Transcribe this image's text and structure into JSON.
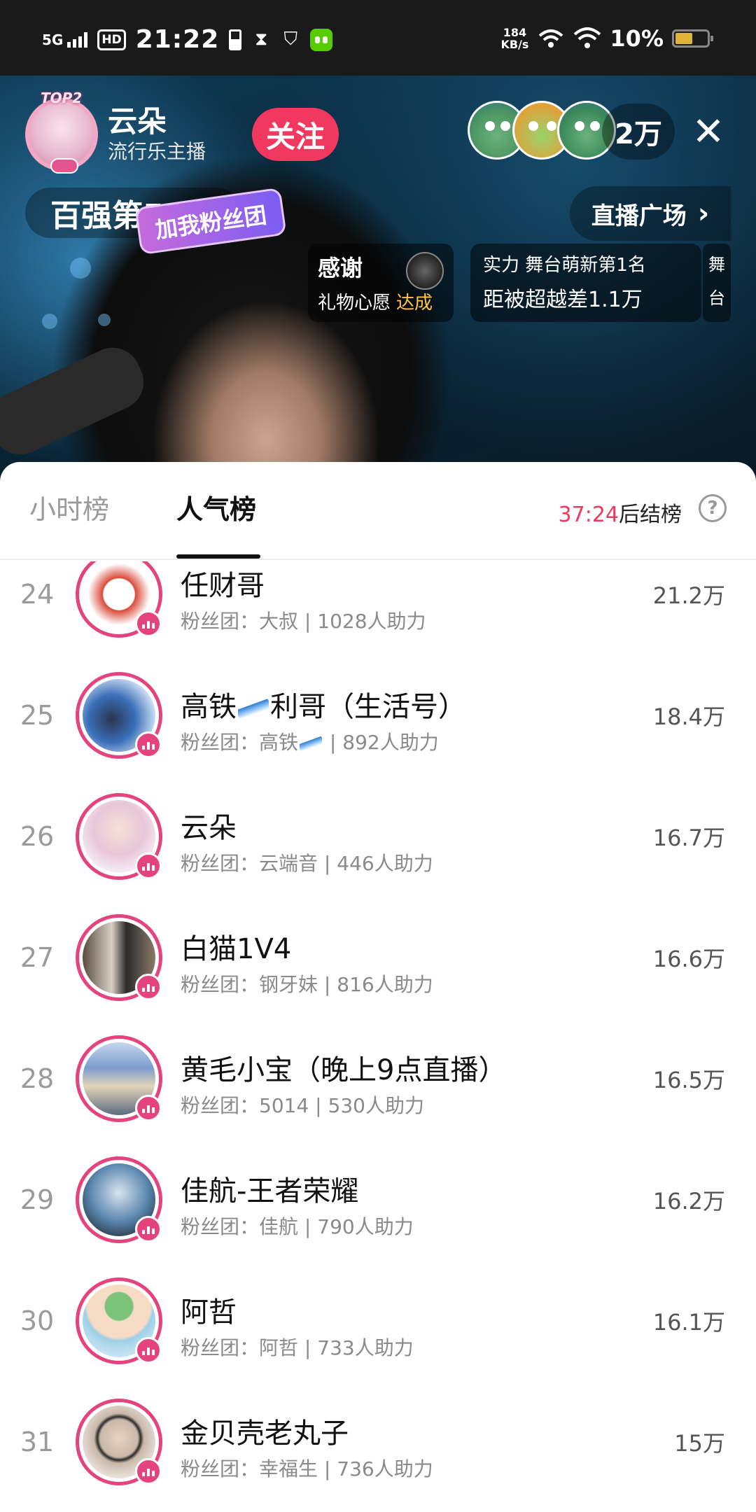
{
  "status_bar": {
    "network": "5G",
    "hd": "HD",
    "time": "21:22",
    "speed_value": "184",
    "speed_unit": "KB/s",
    "battery": "10%"
  },
  "live": {
    "host_badge": "TOP2",
    "host_name": "云朵",
    "host_subtitle": "流行乐主播",
    "follow_label": "关注",
    "viewer_count": "2万",
    "close_symbol": "✕",
    "rank_text": "百强第55名",
    "join_fan_club": "加我粉丝团",
    "plaza_label": "直播广场",
    "thanks_title": "感谢",
    "thanks_sub": "礼物心愿",
    "thanks_status": "达成",
    "stage_top": "实力 舞台萌新第1名",
    "stage_bottom": "距被超越差1.1万",
    "stage_side_1": "舞",
    "stage_side_2": "台"
  },
  "sheet": {
    "tab_hourly": "小时榜",
    "tab_popularity": "人气榜",
    "countdown_time": "37:24",
    "countdown_suffix": "后结榜",
    "help_symbol": "?"
  },
  "ranking": [
    {
      "rank": "24",
      "name": "任财哥",
      "fan_prefix": "粉丝团：",
      "fan_name": "大叔",
      "fan_suffix": " | 1028人助力",
      "score": "21.2万",
      "avatar_color": "#d94a3a"
    },
    {
      "rank": "25",
      "name_a": "高铁",
      "name_b": "利哥（生活号）",
      "fan_prefix": "粉丝团：",
      "fan_name": "高铁",
      "fan_suffix": " | 892人助力",
      "score": "18.4万",
      "avatar_color": "#3a6fb8"
    },
    {
      "rank": "26",
      "name": "云朵",
      "fan_prefix": "粉丝团：",
      "fan_name": "云端音",
      "fan_suffix": " | 446人助力",
      "score": "16.7万",
      "avatar_color": "#e8c6d8"
    },
    {
      "rank": "27",
      "name": "白猫1V4",
      "fan_prefix": "粉丝团：",
      "fan_name": "钢牙妹",
      "fan_suffix": " | 816人助力",
      "score": "16.6万",
      "avatar_color": "#5a4a3e"
    },
    {
      "rank": "28",
      "name": "黄毛小宝（晚上9点直播）",
      "fan_prefix": "粉丝团：",
      "fan_name": "5014",
      "fan_suffix": " | 530人助力",
      "score": "16.5万",
      "avatar_color": "#7a9ccf"
    },
    {
      "rank": "29",
      "name": "佳航-王者荣耀",
      "fan_prefix": "粉丝团：",
      "fan_name": "佳航",
      "fan_suffix": " | 790人助力",
      "score": "16.2万",
      "avatar_color": "#5c88b0"
    },
    {
      "rank": "30",
      "name": "阿哲",
      "fan_prefix": "粉丝团：",
      "fan_name": "阿哲",
      "fan_suffix": " | 733人助力",
      "score": "16.1万",
      "avatar_color": "#9fd0e8"
    },
    {
      "rank": "31",
      "name": "金贝壳老丸子",
      "fan_prefix": "粉丝团：",
      "fan_name": "幸福生",
      "fan_suffix": " | 736人助力",
      "score": "15万",
      "avatar_color": "#c9b7a8"
    }
  ]
}
